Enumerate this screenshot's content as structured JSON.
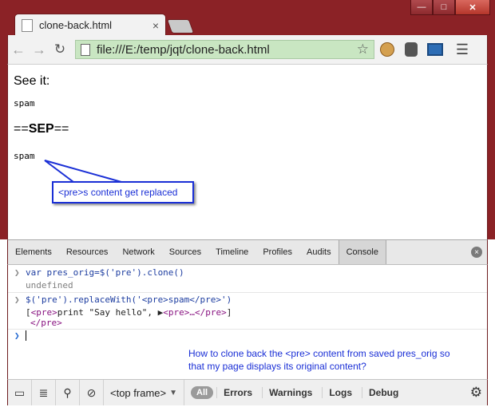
{
  "window": {
    "minimize_glyph": "—",
    "maximize_glyph": "□",
    "close_glyph": "✕"
  },
  "tab": {
    "title": "clone-back.html",
    "close_glyph": "×"
  },
  "toolbar": {
    "back_glyph": "←",
    "forward_glyph": "→",
    "reload_glyph": "↻",
    "url": "file:///E:/temp/jqt/clone-back.html",
    "star_glyph": "☆",
    "menu_glyph": "☰",
    "extensions": [
      "cookie-icon",
      "evernote-icon",
      "monitor-icon"
    ]
  },
  "page": {
    "heading": "See it:",
    "pre1": "spam",
    "sep_prefix": "==",
    "sep_bold": "SEP",
    "sep_suffix": "==",
    "pre2": "spam",
    "callout": "<pre>s content get replaced"
  },
  "devtools": {
    "tabs": [
      "Elements",
      "Resources",
      "Network",
      "Sources",
      "Timeline",
      "Profiles",
      "Audits",
      "Console"
    ],
    "active_tab": "Console",
    "close_glyph": "×",
    "console": {
      "line1": "var pres_orig=$('pre').clone()",
      "line2": "undefined",
      "line3": "$('pre').replaceWith('<pre>spam</pre>')",
      "line4_open": "[",
      "line4_tag1": "<pre>",
      "line4_text": "print \"Say hello\", ",
      "line4_tri": "▶",
      "line4_tag2": "<pre>…</pre>",
      "line4_close": "]",
      "line5_tag": "</pre>",
      "prompt_glyph": "❯",
      "arrow_glyph": "❯"
    },
    "question": "How to clone back the <pre> content from saved pres_orig so that my page displays its original content?",
    "statusbar": {
      "frame": "<top frame>",
      "frame_dd": "▼",
      "all": "All",
      "filters": [
        "Errors",
        "Warnings",
        "Logs",
        "Debug"
      ],
      "gear_glyph": "⚙"
    }
  },
  "colors": {
    "frame": "#8b2226",
    "omnibox": "#c9e6c2",
    "annotation": "#1a2fd6"
  }
}
